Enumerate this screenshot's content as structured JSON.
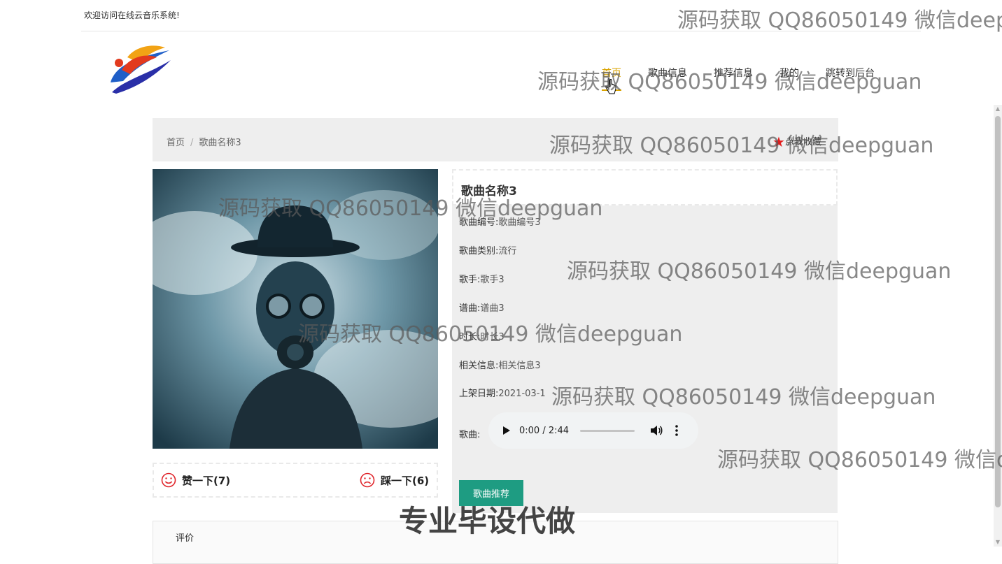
{
  "top": {
    "welcome": "欢迎访问在线云音乐系统!"
  },
  "nav": {
    "items": [
      "首页",
      "歌曲信息",
      "推荐信息",
      "我的",
      "跳转到后台"
    ]
  },
  "breadcrumb": {
    "home": "首页",
    "sep": "/",
    "current": "歌曲名称3",
    "favorite": "点我收藏"
  },
  "song": {
    "title": "歌曲名称3",
    "fields": [
      {
        "label": "歌曲编号:",
        "value": "歌曲编号3"
      },
      {
        "label": "歌曲类别:",
        "value": "流行"
      },
      {
        "label": "歌手:",
        "value": "歌手3"
      },
      {
        "label": "谱曲:",
        "value": "谱曲3"
      },
      {
        "label": "时长:",
        "value": "时长3"
      },
      {
        "label": "相关信息:",
        "value": "相关信息3"
      },
      {
        "label": "上架日期:",
        "value": "2021-03-1"
      }
    ],
    "audio_label": "歌曲:",
    "audio_time": "0:00 / 2:44",
    "recommend_button": "歌曲推荐"
  },
  "votes": {
    "like": "赞一下(7)",
    "dislike": "踩一下(6)"
  },
  "comments": {
    "label": "评价"
  },
  "watermarks": {
    "text": "源码获取 QQ86050149 微信deepguan",
    "partial_top": "源码获取 QQ86050149 微信deep",
    "partial_right": "源码获取 QQ86050149 微信d",
    "bottom": "专业毕设代做"
  },
  "colors": {
    "accent_nav": "#d9a300",
    "button": "#1e9c82",
    "star": "#e21c1c",
    "smile": "#e0262c"
  }
}
